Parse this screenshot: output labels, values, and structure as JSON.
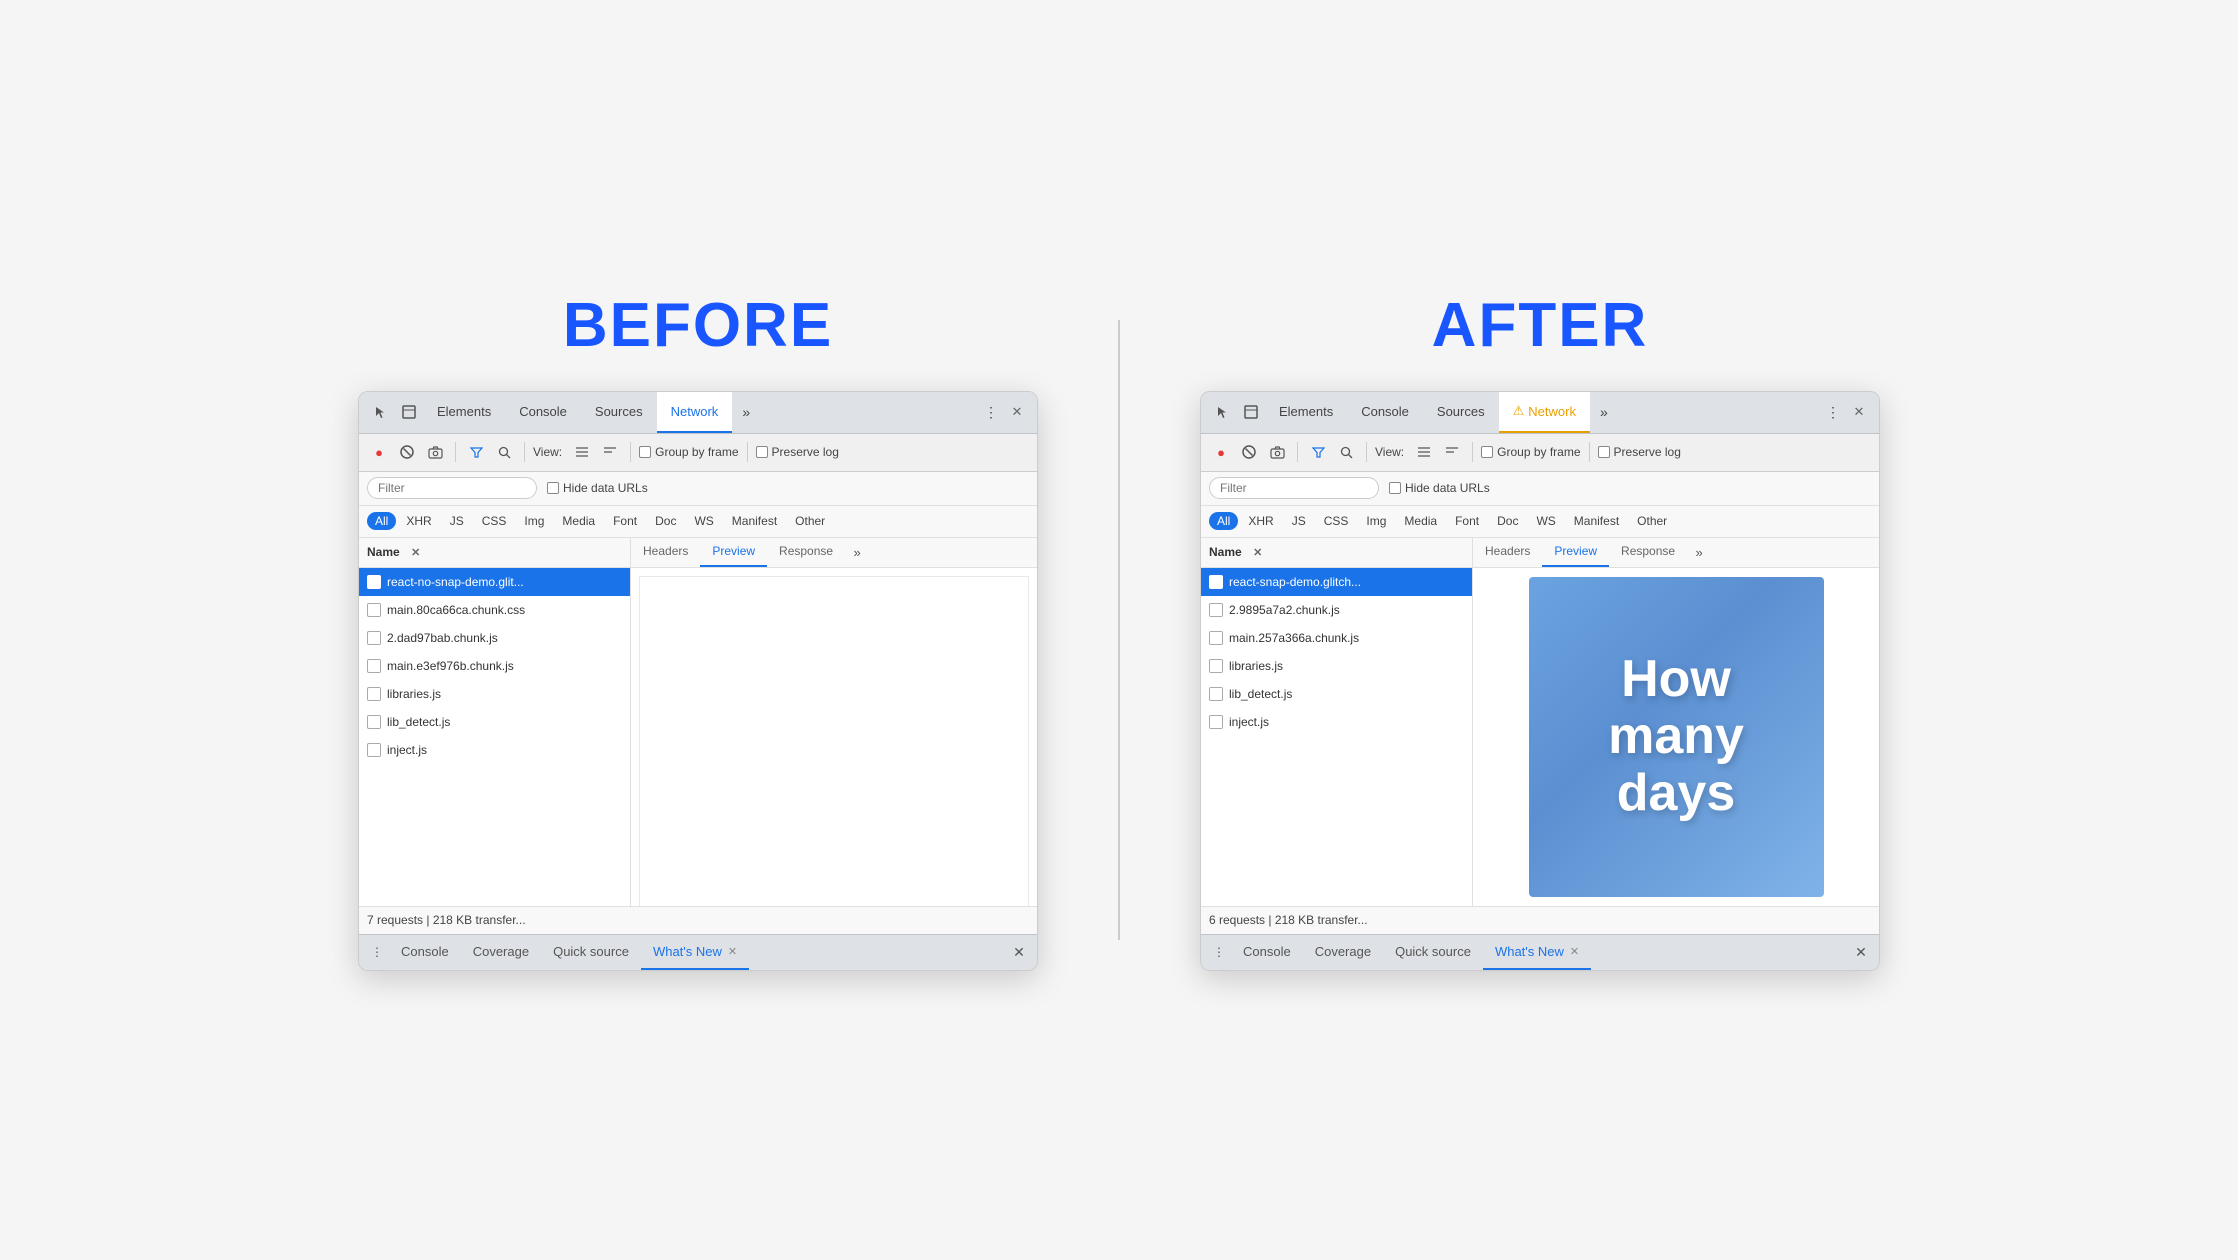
{
  "before": {
    "label": "BEFORE",
    "tabs": {
      "items": [
        "Elements",
        "Console",
        "Sources",
        "Network"
      ],
      "active": "Network",
      "active_index": 3
    },
    "toolbar": {
      "view_label": "View:",
      "group_by_frame": "Group by frame",
      "preserve_log": "Preserve log"
    },
    "filter": {
      "placeholder": "Filter",
      "hide_data_urls": "Hide data URLs"
    },
    "type_filters": [
      "All",
      "XHR",
      "JS",
      "CSS",
      "Img",
      "Media",
      "Font",
      "Doc",
      "WS",
      "Manifest",
      "Other"
    ],
    "active_type": "All",
    "files": {
      "header": "Name",
      "items": [
        "react-no-snap-demo.glit...",
        "main.80ca66ca.chunk.css",
        "2.dad97bab.chunk.js",
        "main.e3ef976b.chunk.js",
        "libraries.js",
        "lib_detect.js",
        "inject.js"
      ],
      "selected_index": 0
    },
    "preview_tabs": [
      "Headers",
      "Preview",
      "Response"
    ],
    "active_preview": "Preview",
    "preview_content": "empty",
    "status": "7 requests | 218 KB transfer...",
    "bottom_tabs": [
      "Console",
      "Coverage",
      "Quick source",
      "What's New"
    ],
    "active_bottom": "What's New"
  },
  "after": {
    "label": "AFTER",
    "tabs": {
      "items": [
        "Elements",
        "Console",
        "Sources",
        "Network"
      ],
      "active": "Network",
      "active_index": 3,
      "warning": true
    },
    "toolbar": {
      "view_label": "View:",
      "group_by_frame": "Group by frame",
      "preserve_log": "Preserve log"
    },
    "filter": {
      "placeholder": "Filter",
      "hide_data_urls": "Hide data URLs"
    },
    "type_filters": [
      "All",
      "XHR",
      "JS",
      "CSS",
      "Img",
      "Media",
      "Font",
      "Doc",
      "WS",
      "Manifest",
      "Other"
    ],
    "active_type": "All",
    "files": {
      "header": "Name",
      "items": [
        "react-snap-demo.glitch...",
        "2.9895a7a2.chunk.js",
        "main.257a366a.chunk.js",
        "libraries.js",
        "lib_detect.js",
        "inject.js"
      ],
      "selected_index": 0
    },
    "preview_tabs": [
      "Headers",
      "Preview",
      "Response"
    ],
    "active_preview": "Preview",
    "preview_content": "image",
    "preview_image_text": [
      "How",
      "many",
      "days"
    ],
    "status": "6 requests | 218 KB transfer...",
    "bottom_tabs": [
      "Console",
      "Coverage",
      "Quick source",
      "What's New"
    ],
    "active_bottom": "What's New"
  },
  "icons": {
    "cursor": "⊹",
    "layers": "⧉",
    "record": "●",
    "stop": "⊘",
    "camera": "🎥",
    "filter": "▼",
    "search": "🔍",
    "list1": "☰",
    "list2": "≡",
    "more": "»",
    "more_vert": "⋮",
    "close": "✕",
    "warning": "⚠"
  }
}
